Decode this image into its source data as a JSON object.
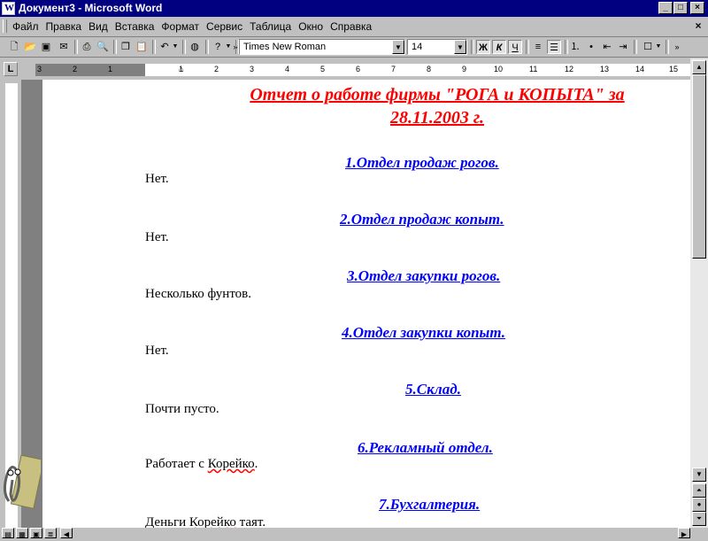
{
  "window": {
    "title": "Документ3 - Microsoft Word",
    "icon": "word-icon"
  },
  "menu": [
    "Файл",
    "Правка",
    "Вид",
    "Вставка",
    "Формат",
    "Сервис",
    "Таблица",
    "Окно",
    "Справка"
  ],
  "toolbar": {
    "font": "Times New Roman",
    "size": "14",
    "bold": "Ж",
    "italic": "К",
    "underline": "Ч"
  },
  "ruler": {
    "ticks": [
      "3",
      "2",
      "1",
      "1",
      "2",
      "3",
      "4",
      "5",
      "6",
      "7",
      "8",
      "9",
      "10",
      "11",
      "12",
      "13",
      "14",
      "15"
    ]
  },
  "document": {
    "title_line1": "Отчет о работе фирмы \"РОГА и КОПЫТА\" за",
    "title_line2": "28.11.2003 г.",
    "sections": [
      {
        "heading": "1.Отдел продаж рогов.",
        "text": "Нет."
      },
      {
        "heading": "2.Отдел продаж копыт.",
        "text": "Нет."
      },
      {
        "heading": "3.Отдел закупки рогов.",
        "text": "Несколько фунтов."
      },
      {
        "heading": "4.Отдел закупки копыт.",
        "text": "Нет."
      },
      {
        "heading": "5.Склад.",
        "text": "Почти пусто."
      },
      {
        "heading": "6.Рекламный отдел.",
        "text_before": "Работает с ",
        "text_marked": "Корейко",
        "text_after": "."
      },
      {
        "heading": "7.Бухгалтерия.",
        "text_before": "Деньги ",
        "text_marked": "Корейко",
        "text_after": " таят."
      }
    ]
  },
  "colors": {
    "titlebar": "#000080",
    "title_text": "#ff0000",
    "heading_text": "#0000ff"
  }
}
